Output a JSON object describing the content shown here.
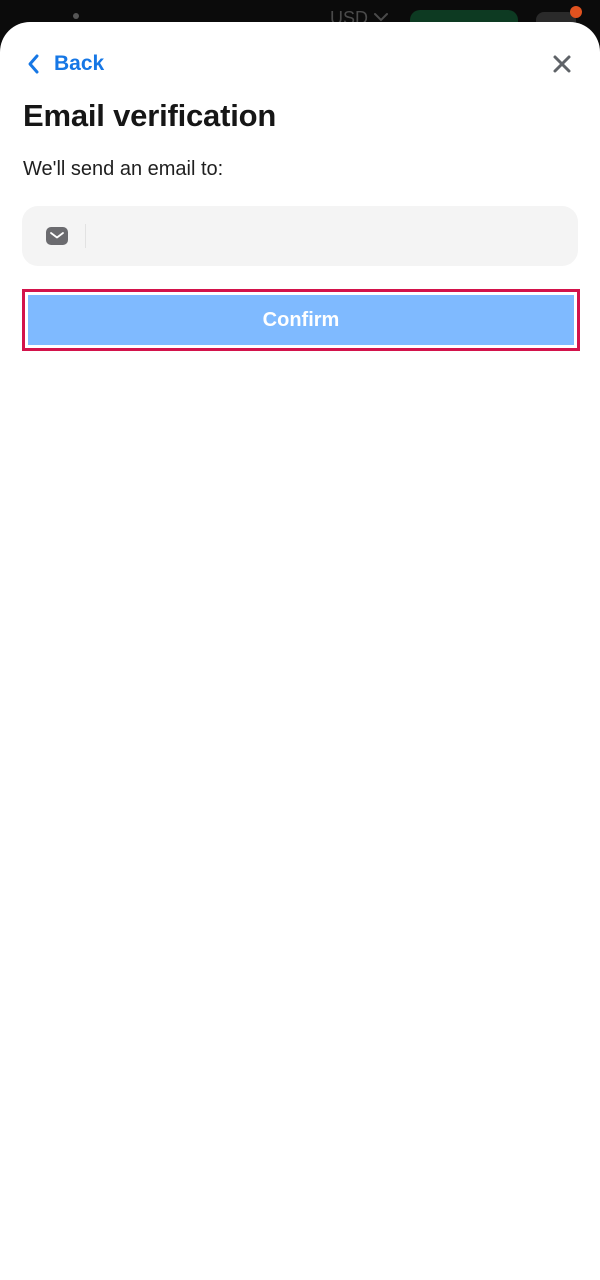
{
  "background": {
    "currency_label": "USD"
  },
  "header": {
    "back_label": "Back",
    "back_icon": "chevron-left-icon",
    "close_icon": "close-icon"
  },
  "page": {
    "title": "Email verification",
    "subtitle": "We'll send an email to:"
  },
  "email_field": {
    "icon": "mail-icon",
    "value": "",
    "placeholder": ""
  },
  "confirm": {
    "label": "Confirm"
  },
  "colors": {
    "accent": "#1677e5",
    "button_disabled": "#7fbaff",
    "highlight_border": "#d3134b",
    "field_bg": "#f4f4f4",
    "icon_gray": "#6b6b6f"
  }
}
